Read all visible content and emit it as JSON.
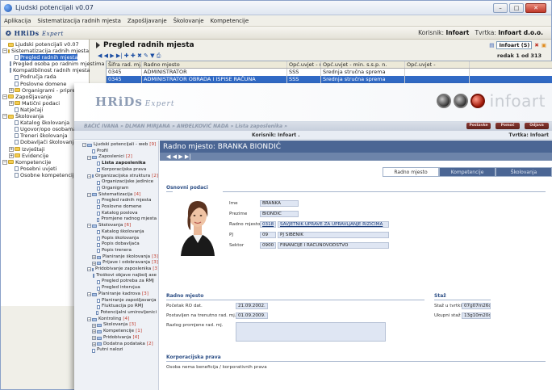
{
  "window": {
    "title": "Ljudski potencijali  v0.07",
    "menu": [
      "Aplikacija",
      "Sistematizacija radnih mjesta",
      "Zapošljavanje",
      "Školovanje",
      "Kompetencije"
    ],
    "logo_main": "HRiDs",
    "logo_sub": "Expert",
    "korisnik_label": "Korisnik:",
    "korisnik_value": "Infoart",
    "tvrtka_label": "Tvrtka:",
    "tvrtka_value": "Infoart d.o.o."
  },
  "tree": [
    {
      "label": "Ljudski potencijali  v0.07",
      "type": "folder",
      "indent": 0,
      "box": ""
    },
    {
      "label": "Sistematizacija radnih mjesta",
      "type": "folder",
      "indent": 0,
      "box": "−"
    },
    {
      "label": "Pregled radnih mjesta",
      "type": "page",
      "indent": 1,
      "box": "",
      "selected": true
    },
    {
      "label": "Pregled osoba po radnim mjestima",
      "type": "page",
      "indent": 1,
      "box": ""
    },
    {
      "label": "Kompatibilnost radnih mjesta",
      "type": "page",
      "indent": 1,
      "box": ""
    },
    {
      "label": "Područja rada",
      "type": "page",
      "indent": 1,
      "box": ""
    },
    {
      "label": "Poslovne domene",
      "type": "page",
      "indent": 1,
      "box": ""
    },
    {
      "label": "Organigrami - priprema",
      "type": "folder",
      "indent": 1,
      "box": "+"
    },
    {
      "label": "Zapošljavanje",
      "type": "folder",
      "indent": 0,
      "box": "−"
    },
    {
      "label": "Matični podaci",
      "type": "folder",
      "indent": 1,
      "box": "+"
    },
    {
      "label": "Natječaji",
      "type": "page",
      "indent": 1,
      "box": ""
    },
    {
      "label": "Školovanja",
      "type": "folder",
      "indent": 0,
      "box": "−"
    },
    {
      "label": "Katalog školovanja",
      "type": "page",
      "indent": 1,
      "box": ""
    },
    {
      "label": "Ugovor/opo osobama",
      "type": "page",
      "indent": 1,
      "box": ""
    },
    {
      "label": "Treneri školovanja",
      "type": "page",
      "indent": 1,
      "box": ""
    },
    {
      "label": "Dobavljači školovanja",
      "type": "page",
      "indent": 1,
      "box": ""
    },
    {
      "label": "Izvještaji",
      "type": "folder",
      "indent": 1,
      "box": "+"
    },
    {
      "label": "Evidencije",
      "type": "folder",
      "indent": 1,
      "box": "+"
    },
    {
      "label": "Kompetencije",
      "type": "folder",
      "indent": 0,
      "box": "−"
    },
    {
      "label": "Posebni uvjeti",
      "type": "page",
      "indent": 1,
      "box": ""
    },
    {
      "label": "Osobne kompetencije - p",
      "type": "page",
      "indent": 1,
      "box": ""
    }
  ],
  "pregled": {
    "title": "Pregled radnih mjesta",
    "filter_select": "Infoart (S)",
    "redak": "redak 1 od 313",
    "nav": "◀ ◀ ▶ ▶| ✚  ✚ ✖  ✎ ▼  ⎙",
    "columns": [
      "Šifra rad. mj.",
      "Radno mjesto",
      "Opć.uvjet - min.",
      "Opć.uvjet - min. s.s.p. n.",
      "Opć.uvjet -"
    ],
    "rows": [
      [
        "0345",
        "ADMINISTRATOR",
        "SSS",
        "Srednja stručna sprema",
        ""
      ],
      [
        "0345",
        "ADMINISTRATOR OBRADA I ISPISE RAČUNA",
        "SSS",
        "Srednja stručna sprema",
        ""
      ]
    ]
  },
  "web": {
    "logo_main": "HRiDs",
    "logo_sub": "Expert",
    "brand": "infoart",
    "breadcrumb": "BAČIĆ IVANA  »  DLMAN MIRJANA  »  ANĐELKOVIĆ NADA  »  Lista zaposlenika  »",
    "top_buttons": [
      "Postavke",
      "Pomoć",
      "Odjava"
    ],
    "korisnik": "Korisnik: Infoart .",
    "tvrtka": "Tvrtka: Infoart"
  },
  "web_tree": [
    {
      "label": "Ljudski potencijali - web",
      "count": "[9]",
      "indent": 0,
      "box": "−",
      "icon": "fold",
      "bold": false
    },
    {
      "label": "Profil",
      "count": "",
      "indent": 1,
      "box": "",
      "icon": "doc",
      "bold": false
    },
    {
      "label": "Zaposlenici",
      "count": "[2]",
      "indent": 1,
      "box": "−",
      "icon": "fold",
      "bold": false
    },
    {
      "label": "Lista zaposlenika",
      "count": "",
      "indent": 2,
      "box": "",
      "icon": "doc",
      "bold": true
    },
    {
      "label": "Korporacijska prava",
      "count": "",
      "indent": 2,
      "box": "",
      "icon": "doc",
      "bold": false
    },
    {
      "label": "Organizacijska struktura",
      "count": "[2]",
      "indent": 1,
      "box": "−",
      "icon": "fold",
      "bold": false
    },
    {
      "label": "Organizacijske jedinice",
      "count": "",
      "indent": 2,
      "box": "",
      "icon": "doc",
      "bold": false
    },
    {
      "label": "Organigram",
      "count": "",
      "indent": 2,
      "box": "",
      "icon": "doc",
      "bold": false
    },
    {
      "label": "Sistematizacija",
      "count": "[4]",
      "indent": 1,
      "box": "−",
      "icon": "fold",
      "bold": false
    },
    {
      "label": "Pregled radnih mjesta",
      "count": "",
      "indent": 2,
      "box": "",
      "icon": "doc",
      "bold": false
    },
    {
      "label": "Poslovne domene",
      "count": "",
      "indent": 2,
      "box": "",
      "icon": "doc",
      "bold": false
    },
    {
      "label": "Katalog poslova",
      "count": "",
      "indent": 2,
      "box": "",
      "icon": "doc",
      "bold": false
    },
    {
      "label": "Promjene radnog mjesta",
      "count": "",
      "indent": 2,
      "box": "",
      "icon": "doc",
      "bold": false
    },
    {
      "label": "Školovanja",
      "count": "[6]",
      "indent": 1,
      "box": "−",
      "icon": "fold",
      "bold": false
    },
    {
      "label": "Katalog školovanja",
      "count": "",
      "indent": 2,
      "box": "",
      "icon": "doc",
      "bold": false
    },
    {
      "label": "Popis školovanja",
      "count": "",
      "indent": 2,
      "box": "",
      "icon": "doc",
      "bold": false
    },
    {
      "label": "Popis dobavljača",
      "count": "",
      "indent": 2,
      "box": "",
      "icon": "doc",
      "bold": false
    },
    {
      "label": "Popis trenera",
      "count": "",
      "indent": 2,
      "box": "",
      "icon": "doc",
      "bold": false
    },
    {
      "label": "Planiranje školovanja",
      "count": "[3]",
      "indent": 2,
      "box": "+",
      "icon": "fold",
      "bold": false
    },
    {
      "label": "Prijave i odobravanja",
      "count": "[3]",
      "indent": 2,
      "box": "+",
      "icon": "fold",
      "bold": false
    },
    {
      "label": "Pridobivanje zaposlenika",
      "count": "[3]",
      "indent": 1,
      "box": "−",
      "icon": "fold",
      "bold": false
    },
    {
      "label": "Troškovi objave najbolj ase",
      "count": "",
      "indent": 2,
      "box": "",
      "icon": "doc",
      "bold": false
    },
    {
      "label": "Pregled potreba za RMJ",
      "count": "",
      "indent": 2,
      "box": "",
      "icon": "doc",
      "bold": false
    },
    {
      "label": "Pregled intervjua",
      "count": "",
      "indent": 2,
      "box": "",
      "icon": "doc",
      "bold": false
    },
    {
      "label": "Planiranje kadrova",
      "count": "[3]",
      "indent": 1,
      "box": "−",
      "icon": "fold",
      "bold": false
    },
    {
      "label": "Planiranje zapošljavanja",
      "count": "",
      "indent": 2,
      "box": "",
      "icon": "doc",
      "bold": false
    },
    {
      "label": "Fluktuacija po RMJ",
      "count": "",
      "indent": 2,
      "box": "",
      "icon": "doc",
      "bold": false
    },
    {
      "label": "Potencijalni umirovljenici",
      "count": "",
      "indent": 2,
      "box": "",
      "icon": "doc",
      "bold": false
    },
    {
      "label": "Kontroling",
      "count": "[4]",
      "indent": 1,
      "box": "−",
      "icon": "fold",
      "bold": false
    },
    {
      "label": "Školovanja",
      "count": "[3]",
      "indent": 2,
      "box": "+",
      "icon": "fold",
      "bold": false
    },
    {
      "label": "Kompetencije",
      "count": "[1]",
      "indent": 2,
      "box": "+",
      "icon": "fold",
      "bold": false
    },
    {
      "label": "Pridobivanja",
      "count": "[4]",
      "indent": 2,
      "box": "+",
      "icon": "fold",
      "bold": false
    },
    {
      "label": "Dodatna podataka",
      "count": "[2]",
      "indent": 2,
      "box": "+",
      "icon": "fold",
      "bold": false
    },
    {
      "label": "Putni nalozi",
      "count": "",
      "indent": 1,
      "box": "",
      "icon": "doc",
      "bold": false
    }
  ],
  "radno": {
    "title": "Radno mjesto: BRANKA BIONDIĆ",
    "nav": "◀ ◀   ▶   ▶|",
    "tabs": [
      "Radno mjesto",
      "Kompetencije",
      "Školovanja"
    ],
    "osnovni_title": "Osnovni podaci",
    "ime_label": "Ime",
    "ime": "BRANKA",
    "prezime_label": "Prezime",
    "prezime": "BIONDIĆ",
    "rm_label": "Radno mjesto",
    "rm_code": "0318",
    "rm_name": "SAVJETNIK UPRAVE ZA UPRAVLJANJE RIZICIMA",
    "pj_label": "PJ",
    "pj_code": "09",
    "pj_name": "PJ ŠIBENIK",
    "sektor_label": "Sektor",
    "sektor_code": "0900",
    "sektor_name": "FINANCIJE I RAČUNOVODSTVO",
    "radno_title": "Radno mjesto",
    "pocetak_label": "Početak RO dat.",
    "pocetak": "21.09.2002.",
    "postavljen_label": "Postavljen na trenutno rad. mj.",
    "postavljen": "01.09.2009.",
    "razlog_label": "Razlog promjene rad. mj.",
    "staz_title": "Staž",
    "staz_tvrtki_label": "Staž u tvrtki",
    "staz_tvrtki": "07g07m26d",
    "ukupni_label": "Ukupni staž",
    "ukupni": "13g10m20d",
    "korp_title": "Korporacijska prava",
    "korp_text": "Osoba nema beneficija / korporativnih prava"
  }
}
